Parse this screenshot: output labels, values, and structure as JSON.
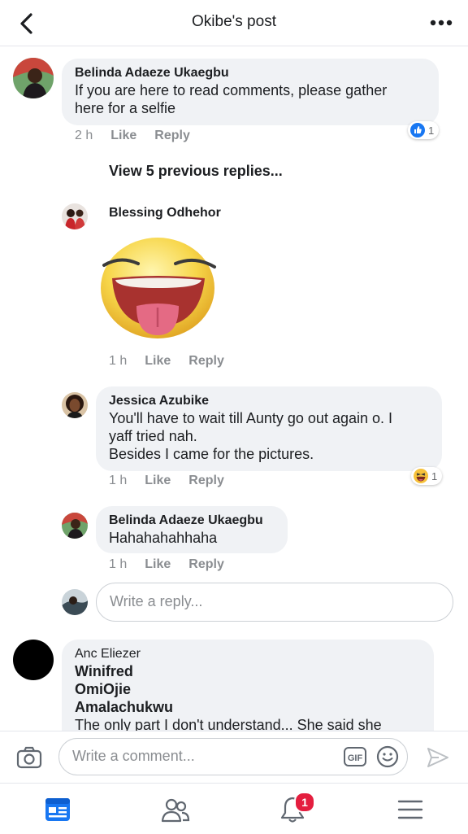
{
  "header": {
    "title": "Okibe's post"
  },
  "comments": [
    {
      "name": "Belinda Adaeze Ukaegbu",
      "text_lines": [
        "If you are here to read comments, please gather",
        "here for a selfie"
      ],
      "time": "2 h",
      "like": "Like",
      "reply": "Reply",
      "reaction_count": "1"
    }
  ],
  "view_previous": "View 5 previous replies...",
  "replies": [
    {
      "name": "Blessing Odhehor",
      "time": "1 h",
      "like": "Like",
      "reply": "Reply"
    },
    {
      "name": "Jessica Azubike",
      "text_lines": [
        "You'll have to wait till Aunty go out again o. I",
        "yaff tried nah.",
        "Besides I came for the pictures."
      ],
      "time": "1 h",
      "like": "Like",
      "reply": "Reply",
      "reaction_count": "1"
    },
    {
      "name": "Belinda Adaeze Ukaegbu",
      "text_lines": [
        "Hahahahahhaha"
      ],
      "time": "1 h",
      "like": "Like",
      "reply": "Reply"
    }
  ],
  "reply_input": {
    "placeholder": "Write a reply..."
  },
  "last_comment": {
    "name": "Anc Eliezer",
    "tags": [
      "Winifred",
      "OmiOjie",
      "Amalachukwu"
    ],
    "text": "The only part I don't understand... She said she"
  },
  "compose": {
    "placeholder": "Write a comment...",
    "gif_label": "GIF"
  },
  "tabbar": {
    "notification_count": "1"
  },
  "colors": {
    "accent": "#1877f2",
    "badge": "#e41e3f",
    "bubble": "#f0f2f5"
  }
}
